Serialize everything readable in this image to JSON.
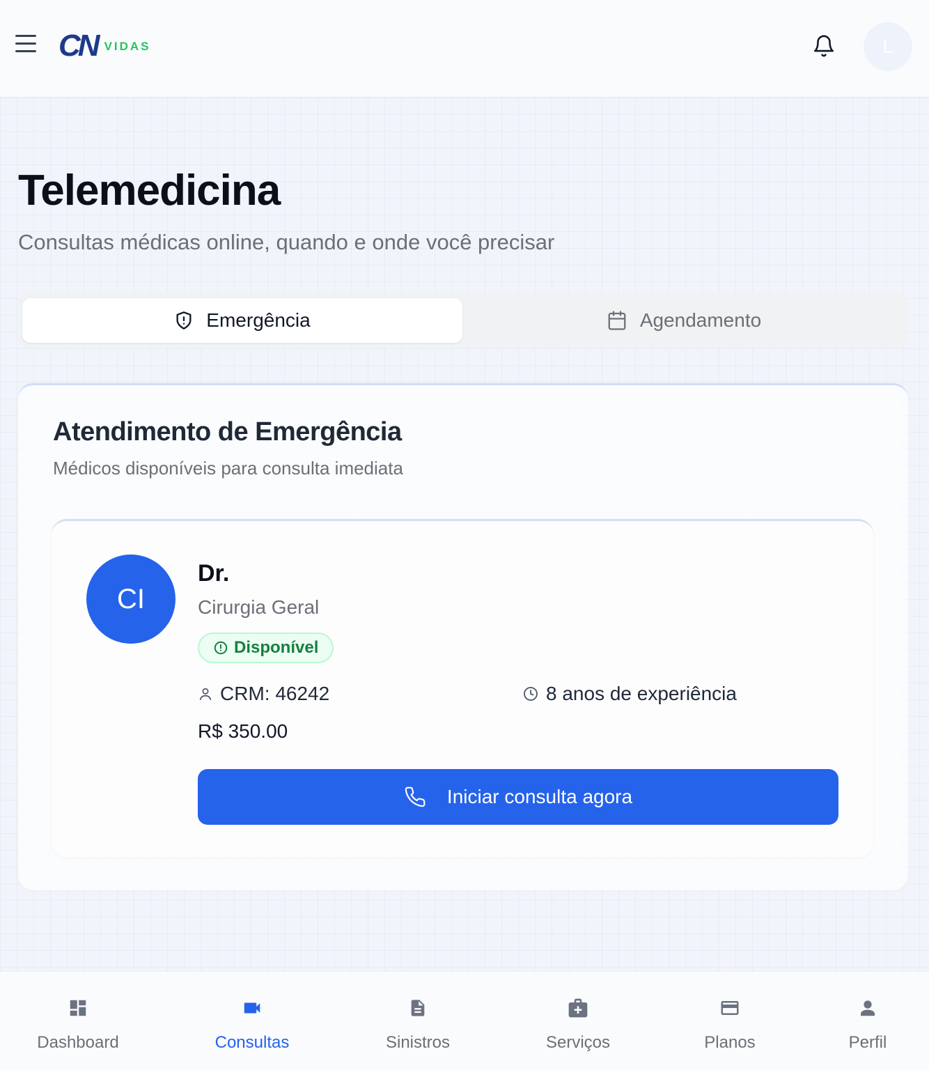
{
  "header": {
    "logo_mark": "CN",
    "logo_text": "VIDAS",
    "avatar_initial": "L"
  },
  "page": {
    "title": "Telemedicina",
    "subtitle": "Consultas médicas online, quando e onde você precisar"
  },
  "tabs": [
    {
      "label": "Emergência",
      "icon": "shield-alert-icon",
      "active": true
    },
    {
      "label": "Agendamento",
      "icon": "calendar-icon",
      "active": false
    }
  ],
  "emergency": {
    "title": "Atendimento de Emergência",
    "subtitle": "Médicos disponíveis para consulta imediata",
    "doctor": {
      "initials": "CI",
      "name": "Dr.",
      "specialty": "Cirurgia Geral",
      "status": "Disponível",
      "crm": "CRM: 46242",
      "experience": "8 anos de experiência",
      "price": "R$ 350.00",
      "cta_label": "Iniciar consulta agora"
    }
  },
  "bottom_nav": [
    {
      "label": "Dashboard",
      "icon": "dashboard-icon",
      "active": false
    },
    {
      "label": "Consultas",
      "icon": "video-camera-icon",
      "active": true
    },
    {
      "label": "Sinistros",
      "icon": "document-icon",
      "active": false
    },
    {
      "label": "Serviços",
      "icon": "medical-kit-icon",
      "active": false
    },
    {
      "label": "Planos",
      "icon": "credit-card-icon",
      "active": false
    },
    {
      "label": "Perfil",
      "icon": "person-icon",
      "active": false
    }
  ],
  "colors": {
    "primary": "#2563eb",
    "logo_blue": "#1e3a8a",
    "logo_green": "#22c55e",
    "available_green": "#15803d"
  }
}
